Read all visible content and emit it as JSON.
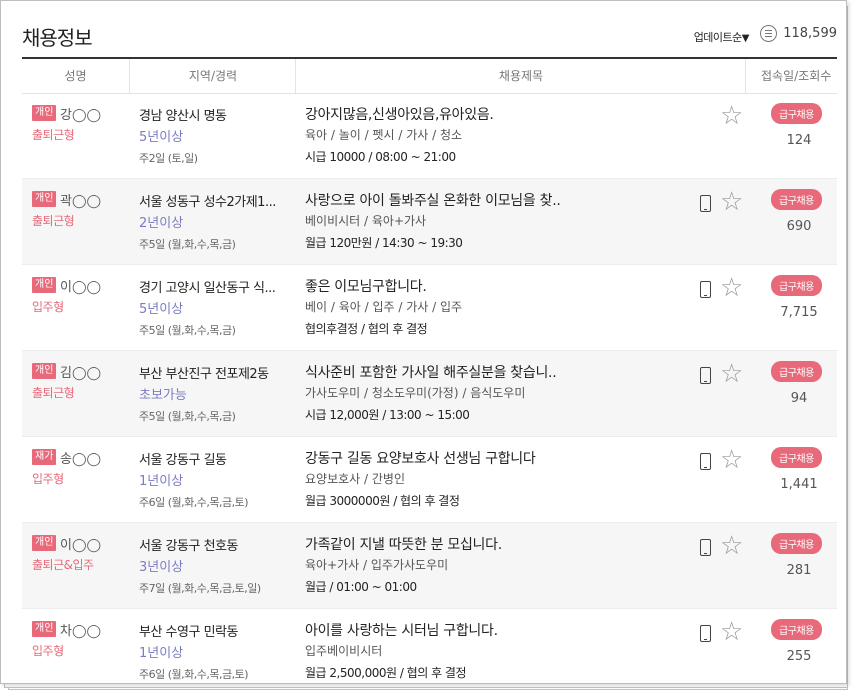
{
  "header": {
    "title": "채용정보",
    "sort_label": "업데이트순",
    "sort_icon": "triangle-down-icon",
    "total_count": "118,599"
  },
  "columns": [
    "성명",
    "지역/경력",
    "채용제목",
    "접속일/조회수"
  ],
  "rows": [
    {
      "badge": "개인",
      "name": "강◯◯",
      "work_type": "출퇴근형",
      "location": "경남 양산시 명동",
      "experience": "5년이상",
      "days": "주2일 (토,일)",
      "title": "강아지많음,신생아있음,유아있음.",
      "categories": "육아 / 놀이 / 펫시 / 가사 / 청소",
      "pay": "시급 10000 / 08:00 ~ 21:00",
      "phone": false,
      "urgent": "급구채용",
      "views": "124"
    },
    {
      "badge": "개인",
      "name": "곽◯◯",
      "work_type": "출퇴근형",
      "location": "서울 성동구 성수2가제1...",
      "experience": "2년이상",
      "days": "주5일 (월,화,수,목,금)",
      "title": "사랑으로 아이 돌봐주실 온화한 이모님을 찾..",
      "categories": "베이비시터 / 육아+가사",
      "pay": "월급 120만원 / 14:30 ~ 19:30",
      "phone": true,
      "urgent": "급구채용",
      "views": "690"
    },
    {
      "badge": "개인",
      "name": "이◯◯",
      "work_type": "입주형",
      "location": "경기 고양시 일산동구 식...",
      "experience": "5년이상",
      "days": "주5일 (월,화,수,목,금)",
      "title": "좋은 이모님구합니다.",
      "categories": "베이 / 육아 / 입주 / 가사 / 입주",
      "pay": "협의후결정 / 협의 후 결정",
      "phone": true,
      "urgent": "급구채용",
      "views": "7,715"
    },
    {
      "badge": "개인",
      "name": "김◯◯",
      "work_type": "출퇴근형",
      "location": "부산 부산진구 전포제2동",
      "experience": "초보가능",
      "days": "주5일 (월,화,수,목,금)",
      "title": "식사준비 포함한 가사일 해주실분을 찾습니..",
      "categories": "가사도우미 / 청소도우미(가정) / 음식도우미",
      "pay": "시급 12,000원 / 13:00 ~ 15:00",
      "phone": true,
      "urgent": "급구채용",
      "views": "94"
    },
    {
      "badge": "재가",
      "name": "송◯◯",
      "work_type": "입주형",
      "location": "서울 강동구 길동",
      "experience": "1년이상",
      "days": "주6일 (월,화,수,목,금,토)",
      "title": "강동구 길동 요양보호사 선생님 구합니다",
      "categories": "요양보호사 / 간병인",
      "pay": "월급 3000000원 / 협의 후 결정",
      "phone": true,
      "urgent": "급구채용",
      "views": "1,441"
    },
    {
      "badge": "개인",
      "name": "이◯◯",
      "work_type": "출퇴근&입주",
      "location": "서울 강동구 천호동",
      "experience": "3년이상",
      "days": "주7일 (월,화,수,목,금,토,일)",
      "title": "가족같이 지낼 따뜻한 분 모십니다.",
      "categories": "육아+가사 / 입주가사도우미",
      "pay": "월급 / 01:00 ~ 01:00",
      "phone": true,
      "urgent": "급구채용",
      "views": "281"
    },
    {
      "badge": "개인",
      "name": "차◯◯",
      "work_type": "입주형",
      "location": "부산 수영구 민락동",
      "experience": "1년이상",
      "days": "주6일 (월,화,수,목,금,토)",
      "title": "아이를 사랑하는 시터님 구합니다.",
      "categories": "입주베이비시터",
      "pay": "월급 2,500,000원 / 협의 후 결정",
      "phone": true,
      "urgent": "급구채용",
      "views": "255"
    }
  ]
}
